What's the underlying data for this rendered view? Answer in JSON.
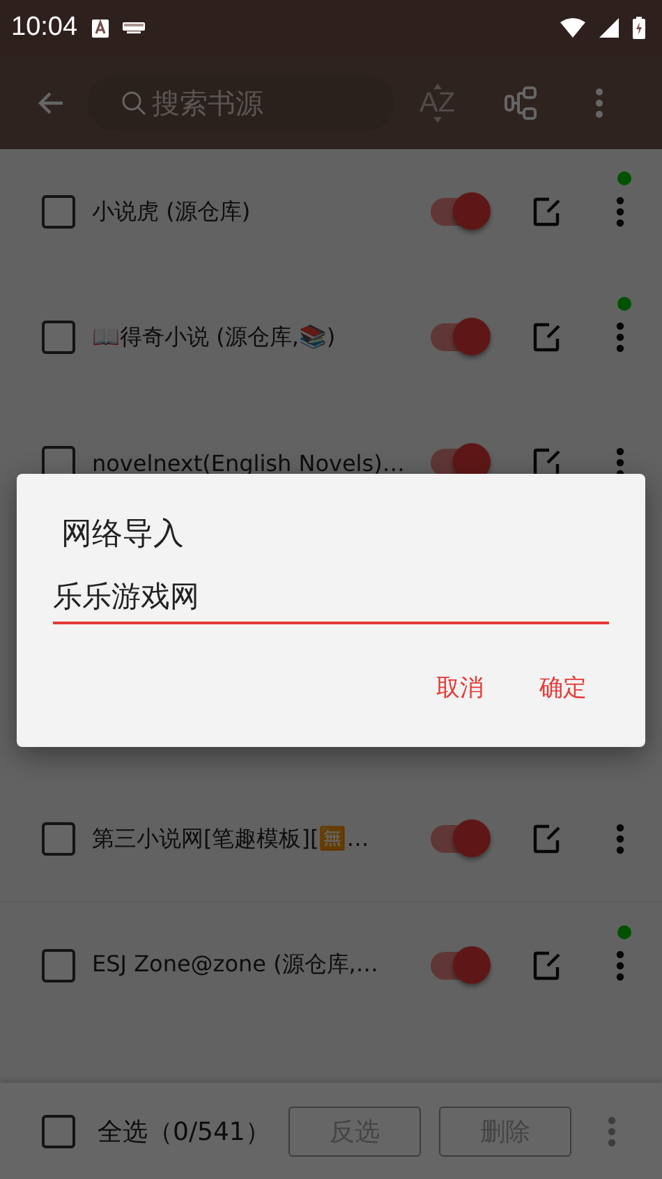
{
  "status_bar": {
    "time": "10:04"
  },
  "toolbar": {
    "search": {
      "placeholder": "搜索书源"
    },
    "sort_label": "AZ"
  },
  "sources": [
    {
      "name": "小说虎 (源仓库)",
      "checked": false,
      "enabled": true,
      "updated": true
    },
    {
      "name": "📖得奇小说 (源仓库,📚)",
      "checked": false,
      "enabled": true,
      "updated": true
    },
    {
      "name": "novelnext(English Novels)…",
      "checked": false,
      "enabled": true,
      "updated": false
    },
    {
      "name": "第三小说网[笔趣模板][🈚…",
      "checked": false,
      "enabled": true,
      "updated": false
    },
    {
      "name": "ESJ Zone@zone (源仓库,…",
      "checked": false,
      "enabled": true,
      "updated": true
    }
  ],
  "bottom_bar": {
    "select_all": {
      "label": "全选（0/541）",
      "checked": false
    },
    "buttons": [
      {
        "label": "反选",
        "disabled": true
      },
      {
        "label": "删除",
        "disabled": true
      }
    ],
    "more_disabled": true
  },
  "dialog": {
    "title": "网络导入",
    "value": "乐乐游戏网",
    "buttons": [
      "取消",
      "确定"
    ]
  }
}
